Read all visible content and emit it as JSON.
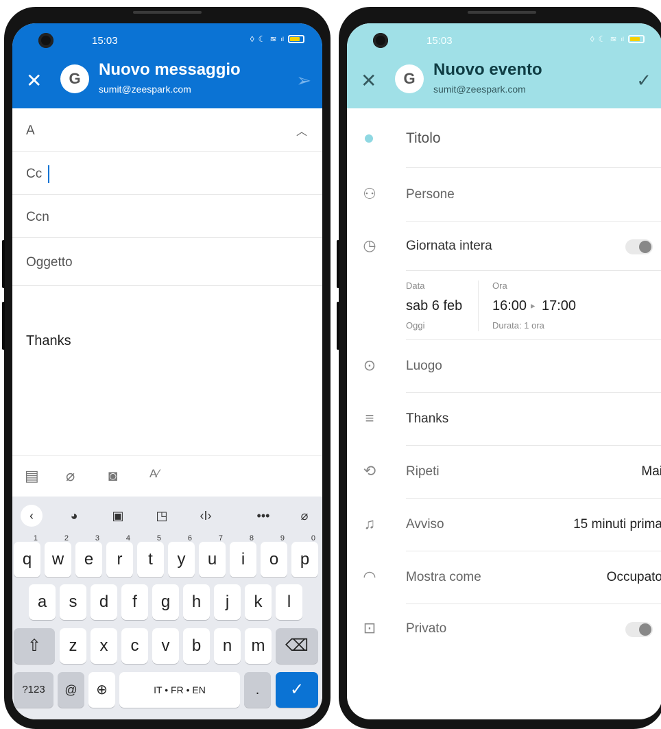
{
  "email": {
    "status": {
      "time": "15:03"
    },
    "appbar": {
      "title": "Nuovo messaggio",
      "account": "sumit@zeespark.com",
      "avatar_letter": "G",
      "close_icon": "close-icon",
      "send_icon": "send-icon"
    },
    "fields": {
      "to": "A",
      "cc": "Cc",
      "bcc": "Ccn",
      "subject": "Oggetto"
    },
    "body": "Thanks",
    "toolbar": [
      "calendar-add-icon",
      "attach-icon",
      "camera-icon",
      "format-text-icon"
    ],
    "keyboard": {
      "row1": [
        [
          "q",
          "1"
        ],
        [
          "w",
          "2"
        ],
        [
          "e",
          "3"
        ],
        [
          "r",
          "4"
        ],
        [
          "t",
          "5"
        ],
        [
          "y",
          "6"
        ],
        [
          "u",
          "7"
        ],
        [
          "i",
          "8"
        ],
        [
          "o",
          "9"
        ],
        [
          "p",
          "0"
        ]
      ],
      "row2": [
        "a",
        "s",
        "d",
        "f",
        "g",
        "h",
        "j",
        "k",
        "l"
      ],
      "row3": [
        "z",
        "x",
        "c",
        "v",
        "b",
        "n",
        "m"
      ],
      "num_key": "?123",
      "at_key": "@",
      "space_label": "IT • FR • EN",
      "period_key": "."
    }
  },
  "event": {
    "status": {
      "time": "15:03"
    },
    "appbar": {
      "title": "Nuovo evento",
      "account": "sumit@zeespark.com",
      "avatar_letter": "G"
    },
    "title_placeholder": "Titolo",
    "people": "Persone",
    "all_day": "Giornata intera",
    "date_label": "Data",
    "date_value": "sab 6 feb",
    "date_sub": "Oggi",
    "time_label": "Ora",
    "time_start": "16:00",
    "time_end": "17:00",
    "duration": "Durata: 1 ora",
    "location": "Luogo",
    "description": "Thanks",
    "repeat_label": "Ripeti",
    "repeat_value": "Mai",
    "alert_label": "Avviso",
    "alert_value": "15 minuti prima",
    "show_as_label": "Mostra come",
    "show_as_value": "Occupato",
    "private_label": "Privato",
    "all_day_on": false,
    "private_on": false
  }
}
